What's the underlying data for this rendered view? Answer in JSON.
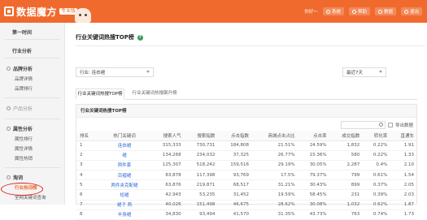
{
  "header": {
    "logo_text": "数据魔方",
    "logo_tag": "专业版",
    "nav": [
      {
        "label": "你好～",
        "type": "notice"
      },
      {
        "label": "系统",
        "type": "button"
      },
      {
        "label": "帮助",
        "type": "button"
      },
      {
        "label": "数据",
        "type": "button"
      },
      {
        "label": "退出",
        "type": "button"
      }
    ]
  },
  "sidebar": {
    "items": [
      {
        "label": "第一时间",
        "kind": "head"
      },
      {
        "label": "行业分析",
        "kind": "head"
      },
      {
        "label": "品牌分析",
        "kind": "section"
      },
      {
        "label": "品牌详情",
        "kind": "sub"
      },
      {
        "label": "品牌排行",
        "kind": "sub"
      },
      {
        "label": "产品分析",
        "kind": "section-muted"
      },
      {
        "label": "属性分析",
        "kind": "section"
      },
      {
        "label": "属性排行",
        "kind": "sub"
      },
      {
        "label": "属性详情",
        "kind": "sub"
      },
      {
        "label": "属性热销",
        "kind": "sub"
      },
      {
        "label": "淘词",
        "kind": "section"
      },
      {
        "label": "行业热词榜",
        "kind": "sub-active"
      },
      {
        "label": "全网关键词查询",
        "kind": "sub"
      }
    ]
  },
  "main": {
    "title": "行业关键词热搜TOP榜",
    "filters": {
      "industry": "行业: 连衣裙",
      "period": "最近7天"
    },
    "tabs": [
      {
        "label": "行业关键词热搜TOP榜",
        "active": true
      },
      {
        "label": "行业关键词热搜飙升榜",
        "active": false
      }
    ],
    "panel_title": "行业关键词热搜TOP榜",
    "export_label": "导出数据"
  },
  "table": {
    "columns": [
      "排名",
      "热门关键词",
      "搜索人气",
      "搜索指数",
      "点击指数",
      "商城点击占比",
      "点击率",
      "成交指数",
      "转化率",
      "直通车"
    ],
    "rows": [
      [
        "1",
        "连衣裙",
        "315,333",
        "730,731",
        "184,808",
        "21.51%",
        "24.59%",
        "1,832",
        "0.22%",
        "1.91"
      ],
      [
        "2",
        "裙",
        "134,268",
        "234,032",
        "37,325",
        "26.77%",
        "15.36%",
        "580",
        "0.22%",
        "1.33"
      ],
      [
        "3",
        "两件套",
        "125,307",
        "518,242",
        "159,516",
        "29.19%",
        "30.05%",
        "2,287",
        "0.4%",
        "2.10"
      ],
      [
        "4",
        "百褶裙",
        "83,878",
        "117,398",
        "93,769",
        "17.5%",
        "79.37%",
        "799",
        "0.61%",
        "1.54"
      ],
      [
        "5",
        "两件夹克配裙",
        "63,876",
        "219,871",
        "68,517",
        "31.21%",
        "30.43%",
        "899",
        "0.37%",
        "2.05"
      ],
      [
        "6",
        "短裙",
        "42,943",
        "53,235",
        "31,452",
        "19.59%",
        "58.45%",
        "231",
        "0.39%",
        "2.03"
      ],
      [
        "7",
        "裙子 两",
        "40,026",
        "151,498",
        "46,675",
        "28.62%",
        "30.08%",
        "1,032",
        "0.62%",
        "1.87"
      ],
      [
        "8",
        "半身裙",
        "34,830",
        "93,494",
        "41,570",
        "31.35%",
        "43.73%",
        "763",
        "0.74%",
        "1.73"
      ]
    ]
  }
}
